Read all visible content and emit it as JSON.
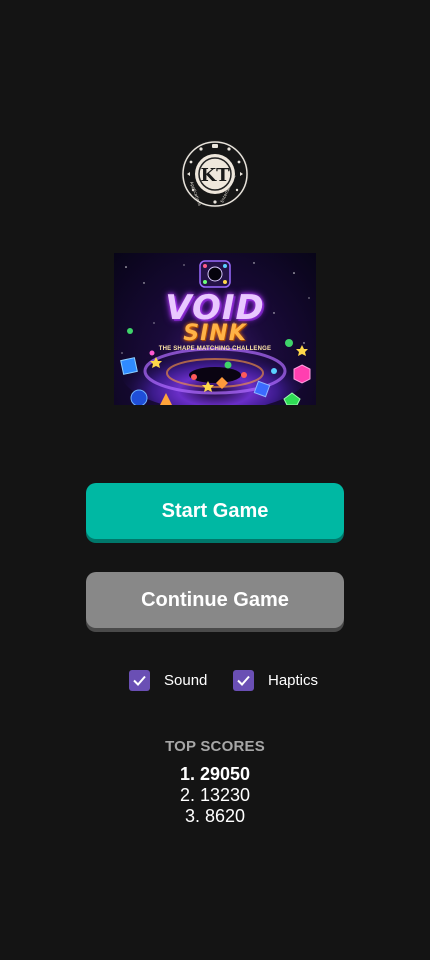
{
  "logo": {
    "icon": "kt-logo-icon",
    "monogram": "KT",
    "ring_text_left": "Applications",
    "ring_text_right": "Entertainment"
  },
  "game_art": {
    "title_line1": "VOID",
    "title_line2": "SINK",
    "subtitle": "THE SHAPE MATCHING CHALLENGE"
  },
  "buttons": {
    "start": "Start Game",
    "continue": "Continue Game"
  },
  "settings": {
    "sound": {
      "label": "Sound",
      "checked": true
    },
    "haptics": {
      "label": "Haptics",
      "checked": true
    }
  },
  "scores": {
    "title": "TOP SCORES",
    "entries": [
      "1. 29050",
      "2. 13230",
      "3. 8620"
    ]
  },
  "colors": {
    "background": "#141414",
    "start_button": "#00b8a3",
    "continue_button": "#888888",
    "checkbox": "#6a4fb4"
  }
}
